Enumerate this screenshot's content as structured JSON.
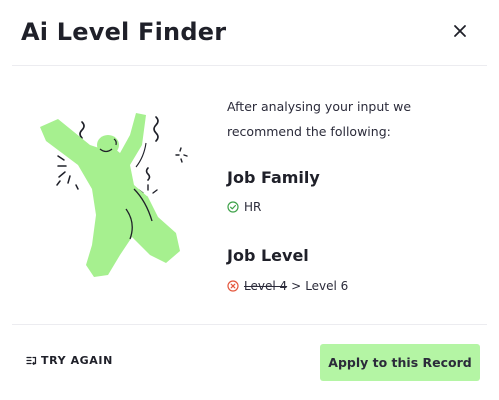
{
  "modal": {
    "title": "Ai Level Finder",
    "close_icon": "close-icon"
  },
  "result": {
    "intro": "After analysing your input we recommend the following:",
    "job_family": {
      "title": "Job Family",
      "status_icon": "check-circle-icon",
      "status_color": "#3fa24a",
      "value": "HR"
    },
    "job_level": {
      "title": "Job Level",
      "status_icon": "x-circle-icon",
      "status_color": "#e4573d",
      "old_value": "Level 4",
      "separator": ">",
      "new_value": "Level 6"
    }
  },
  "footer": {
    "try_again_icon": "retry-list-icon",
    "try_again_label": "TRY AGAIN",
    "apply_label": "Apply to this Record"
  },
  "colors": {
    "accent": "#b4f5a4",
    "text": "#2b2b3a",
    "divider": "#ececf0"
  }
}
